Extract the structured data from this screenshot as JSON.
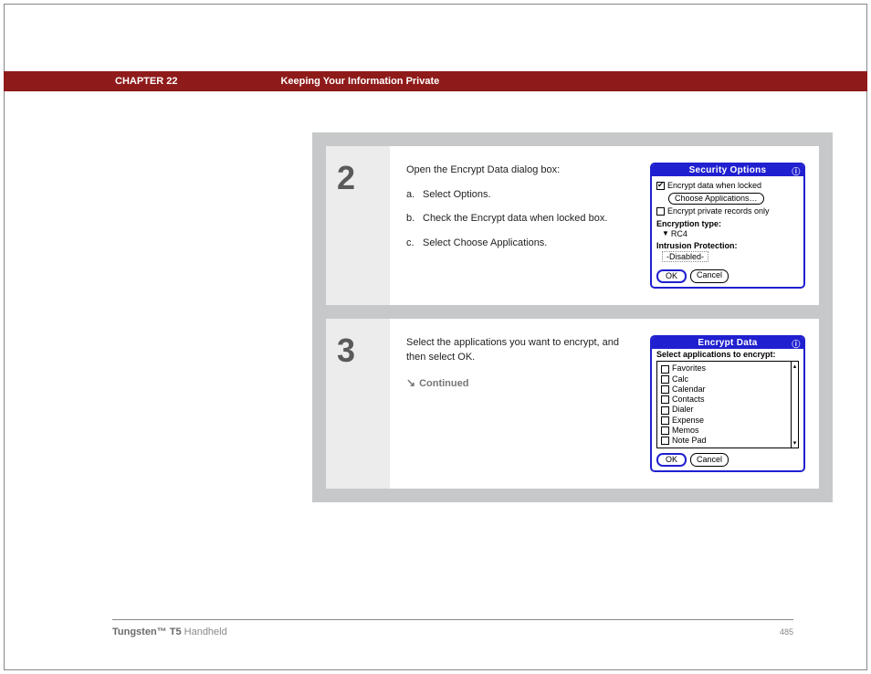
{
  "header": {
    "chapter": "CHAPTER 22",
    "title": "Keeping Your Information Private"
  },
  "steps": [
    {
      "number": "2",
      "intro": "Open the Encrypt Data dialog box:",
      "items": [
        {
          "marker": "a.",
          "text": "Select Options."
        },
        {
          "marker": "b.",
          "text": "Check the Encrypt data when locked box."
        },
        {
          "marker": "c.",
          "text": "Select Choose Applications."
        }
      ],
      "screen": {
        "title": "Security Options",
        "check1_label": "Encrypt data when locked",
        "check1_checked": "✔",
        "choose_btn": "Choose Applications…",
        "check2_label": "Encrypt private records only",
        "enc_type_label": "Encryption type:",
        "enc_type_value": "RC4",
        "intrusion_label": "Intrusion Protection:",
        "intrusion_value": "-Disabled-",
        "ok": "OK",
        "cancel": "Cancel"
      }
    },
    {
      "number": "3",
      "intro": "Select the applications you want to encrypt, and then select OK.",
      "continued": "Continued",
      "screen": {
        "title": "Encrypt Data",
        "prompt": "Select applications to encrypt:",
        "apps": [
          "Favorites",
          "Calc",
          "Calendar",
          "Contacts",
          "Dialer",
          "Expense",
          "Memos",
          "Note Pad"
        ],
        "ok": "OK",
        "cancel": "Cancel"
      }
    }
  ],
  "footer": {
    "product_bold": "Tungsten™ T5",
    "product_light": " Handheld",
    "page": "485"
  }
}
